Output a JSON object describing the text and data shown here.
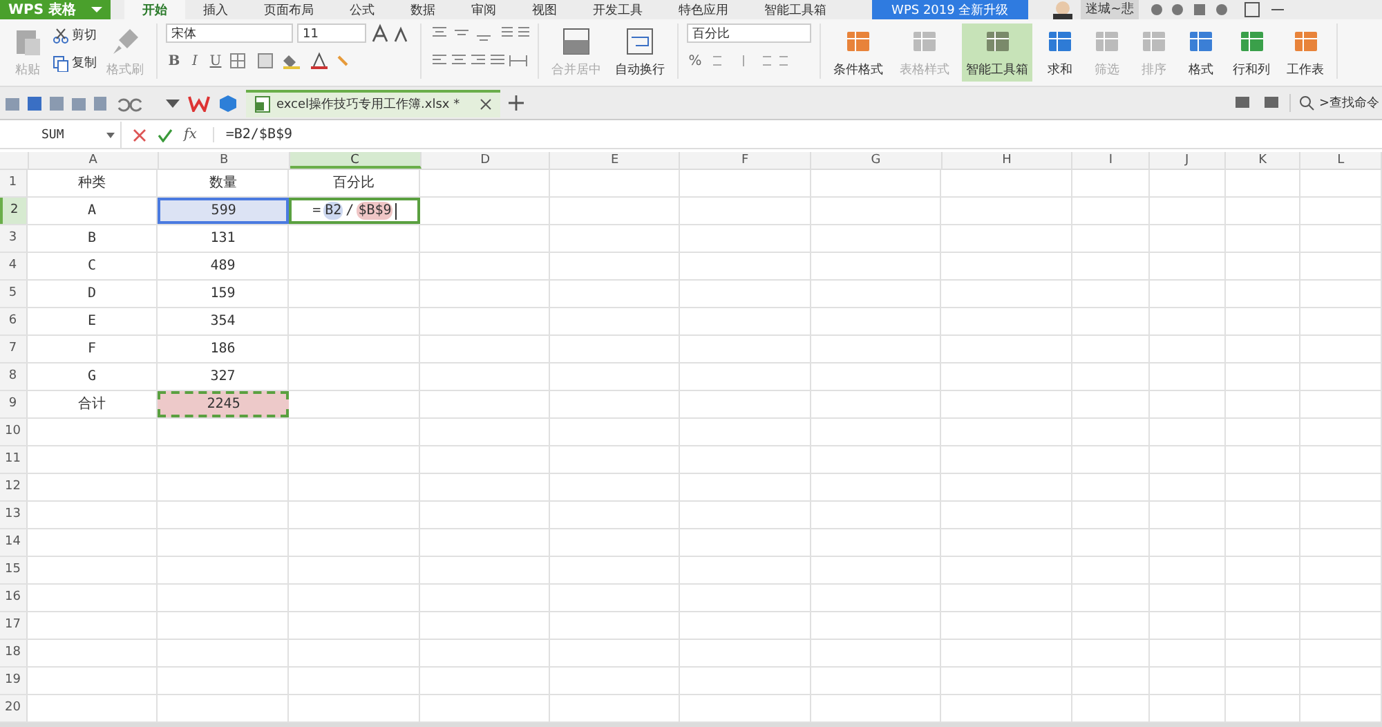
{
  "app_button": {
    "label": "WPS 表格"
  },
  "menu_tabs": [
    {
      "label": "开始",
      "selected": true
    },
    {
      "label": "插入",
      "selected": false
    },
    {
      "label": "页面布局",
      "selected": false
    },
    {
      "label": "公式",
      "selected": false
    },
    {
      "label": "数据",
      "selected": false
    },
    {
      "label": "审阅",
      "selected": false
    },
    {
      "label": "视图",
      "selected": false
    },
    {
      "label": "开发工具",
      "selected": false
    },
    {
      "label": "特色应用",
      "selected": false
    },
    {
      "label": "智能工具箱",
      "selected": false
    }
  ],
  "upgrade_banner": "WPS 2019 全新升级",
  "user": {
    "name": "迷城~悲"
  },
  "clipboard": {
    "paste": {
      "label": "粘贴",
      "disabled": true
    },
    "cut": "剪切",
    "copy": "复制",
    "format_painter": {
      "label": "格式刷",
      "disabled": true
    }
  },
  "font": {
    "family": "宋体",
    "size": "11",
    "styles": [
      "B",
      "I",
      "U"
    ]
  },
  "align_tools": [
    {
      "label": "合并居中",
      "disabled": true
    },
    {
      "label": "自动换行",
      "disabled": false
    }
  ],
  "number": {
    "format": "百分比",
    "percent": "%"
  },
  "tools": [
    {
      "label": "条件格式",
      "disabled": false,
      "highlighted": false
    },
    {
      "label": "表格样式",
      "disabled": true,
      "highlighted": false
    },
    {
      "label": "智能工具箱",
      "disabled": false,
      "highlighted": true
    },
    {
      "label": "求和",
      "disabled": false,
      "highlighted": false
    },
    {
      "label": "筛选",
      "disabled": true,
      "highlighted": false
    },
    {
      "label": "排序",
      "disabled": true,
      "highlighted": false
    },
    {
      "label": "格式",
      "disabled": false,
      "highlighted": false
    },
    {
      "label": "行和列",
      "disabled": false,
      "highlighted": false
    },
    {
      "label": "工作表",
      "disabled": false,
      "highlighted": false
    }
  ],
  "doc_tab": {
    "title": "excel操作技巧专用工作簿.xlsx *"
  },
  "search": {
    "placeholder": ">查找命令"
  },
  "formula_bar": {
    "name_box": "SUM",
    "fx": "fx",
    "formula": "=B2/$B$9"
  },
  "columns": [
    {
      "label": "A",
      "selected": false
    },
    {
      "label": "B",
      "selected": false
    },
    {
      "label": "C",
      "selected": true
    },
    {
      "label": "D",
      "selected": false
    },
    {
      "label": "E",
      "selected": false
    },
    {
      "label": "F",
      "selected": false
    },
    {
      "label": "G",
      "selected": false
    },
    {
      "label": "H",
      "selected": false
    },
    {
      "label": "I",
      "selected": false
    },
    {
      "label": "J",
      "selected": false
    },
    {
      "label": "K",
      "selected": false
    },
    {
      "label": "L",
      "selected": false
    }
  ],
  "rows": [
    {
      "label": "1",
      "selected": false,
      "cells": [
        {
          "text": "种类"
        },
        {
          "text": "数量"
        },
        {
          "text": "百分比"
        }
      ]
    },
    {
      "label": "2",
      "selected": true,
      "cells": [
        {
          "text": "A"
        },
        {
          "text": "599",
          "color": "#dce3f4"
        },
        {
          "kind": "editing",
          "parts": [
            {
              "text": "=",
              "kind": "plain"
            },
            {
              "text": "B2",
              "kind": "ref",
              "color": "#cdd8f0"
            },
            {
              "text": "/",
              "kind": "plain"
            },
            {
              "text": "$B$9",
              "kind": "ref",
              "color": "#efc6c6"
            }
          ]
        }
      ]
    },
    {
      "label": "3",
      "selected": false,
      "cells": [
        {
          "text": "B"
        },
        {
          "text": "131"
        }
      ]
    },
    {
      "label": "4",
      "selected": false,
      "cells": [
        {
          "text": "C"
        },
        {
          "text": "489"
        }
      ]
    },
    {
      "label": "5",
      "selected": false,
      "cells": [
        {
          "text": "D"
        },
        {
          "text": "159"
        }
      ]
    },
    {
      "label": "6",
      "selected": false,
      "cells": [
        {
          "text": "E"
        },
        {
          "text": "354"
        }
      ]
    },
    {
      "label": "7",
      "selected": false,
      "cells": [
        {
          "text": "F"
        },
        {
          "text": "186"
        }
      ]
    },
    {
      "label": "8",
      "selected": false,
      "cells": [
        {
          "text": "G"
        },
        {
          "text": "327"
        }
      ]
    },
    {
      "label": "9",
      "selected": false,
      "cells": [
        {
          "text": "合计"
        },
        {
          "text": "2245",
          "color": "#edc9c9"
        }
      ]
    },
    {
      "label": "10",
      "selected": false,
      "cells": []
    },
    {
      "label": "11",
      "selected": false,
      "cells": []
    },
    {
      "label": "12",
      "selected": false,
      "cells": []
    },
    {
      "label": "13",
      "selected": false,
      "cells": []
    },
    {
      "label": "14",
      "selected": false,
      "cells": []
    },
    {
      "label": "15",
      "selected": false,
      "cells": []
    },
    {
      "label": "16",
      "selected": false,
      "cells": []
    },
    {
      "label": "17",
      "selected": false,
      "cells": []
    },
    {
      "label": "18",
      "selected": false,
      "cells": []
    },
    {
      "label": "19",
      "selected": false,
      "cells": []
    },
    {
      "label": "20",
      "selected": false,
      "cells": []
    }
  ]
}
